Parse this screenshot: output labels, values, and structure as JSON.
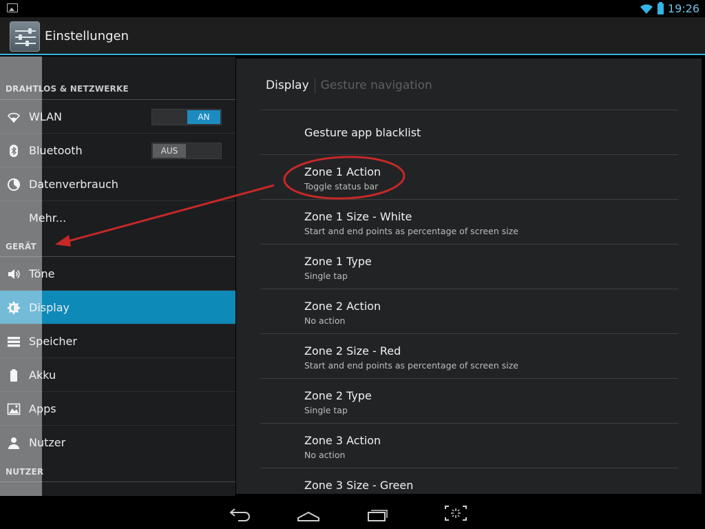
{
  "status_bar": {
    "time": "19:26",
    "left_icon": "image-notification-icon",
    "icons": [
      "wifi-icon",
      "battery-icon"
    ]
  },
  "action_bar": {
    "title": "Einstellungen",
    "icon": "settings-sliders-icon"
  },
  "sidebar": {
    "categories": {
      "wireless": "DRAHTLOS & NETZWERKE",
      "device": "GERÄT",
      "user": "NUTZER"
    },
    "items": [
      {
        "label": "WLAN",
        "icon": "wifi-icon",
        "toggle": "AN"
      },
      {
        "label": "Bluetooth",
        "icon": "bluetooth-icon",
        "toggle": "AUS"
      },
      {
        "label": "Datenverbrauch",
        "icon": "data-usage-icon"
      },
      {
        "label": "Mehr...",
        "icon": ""
      },
      {
        "label": "Töne",
        "icon": "speaker-icon"
      },
      {
        "label": "Display",
        "icon": "brightness-icon",
        "active": true
      },
      {
        "label": "Speicher",
        "icon": "storage-icon"
      },
      {
        "label": "Akku",
        "icon": "battery-icon"
      },
      {
        "label": "Apps",
        "icon": "apps-icon"
      },
      {
        "label": "Nutzer",
        "icon": "user-icon"
      }
    ]
  },
  "main": {
    "tabs": [
      {
        "label": "Display",
        "active": true
      },
      {
        "label": "Gesture navigation",
        "active": false
      }
    ],
    "rows": [
      {
        "title": "Gesture app blacklist",
        "subtitle": ""
      },
      {
        "title": "Zone 1 Action",
        "subtitle": "Toggle status bar",
        "highlighted": true
      },
      {
        "title": "Zone 1 Size - White",
        "subtitle": "Start and end points as percentage of screen size"
      },
      {
        "title": "Zone 1 Type",
        "subtitle": "Single tap"
      },
      {
        "title": "Zone 2 Action",
        "subtitle": "No action"
      },
      {
        "title": "Zone 2 Size - Red",
        "subtitle": "Start and end points as percentage of screen size"
      },
      {
        "title": "Zone 2 Type",
        "subtitle": "Single tap"
      },
      {
        "title": "Zone 3 Action",
        "subtitle": "No action"
      },
      {
        "title": "Zone 3 Size - Green",
        "subtitle": ""
      }
    ]
  },
  "nav_bar": {
    "buttons": [
      "back-icon",
      "home-icon",
      "recents-icon",
      "screenshot-icon"
    ]
  },
  "colors": {
    "accent": "#33b5e5",
    "active_item": "#0e8ab8",
    "annotation": "#c62828"
  }
}
